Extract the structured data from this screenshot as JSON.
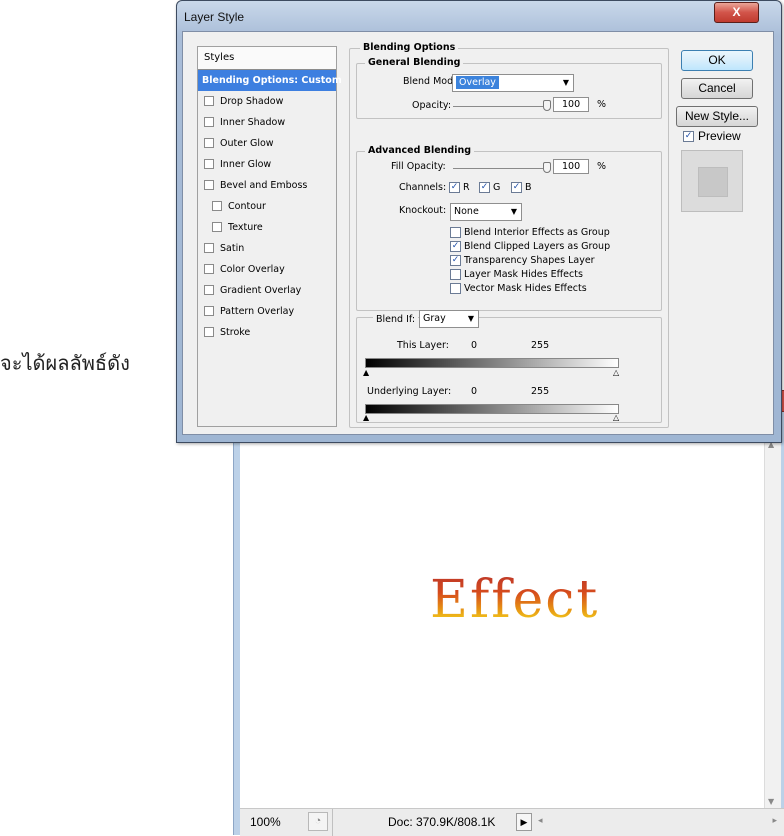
{
  "caption": "จะได้ผลลัพธ์ดัง",
  "dialog": {
    "title": "Layer Style",
    "close_label": "X"
  },
  "styles_panel": {
    "header": "Styles",
    "items": [
      {
        "label": "Blending Options: Custom",
        "checked": false,
        "active": true
      },
      {
        "label": "Drop Shadow",
        "checked": false
      },
      {
        "label": "Inner Shadow",
        "checked": false
      },
      {
        "label": "Outer Glow",
        "checked": false
      },
      {
        "label": "Inner Glow",
        "checked": false
      },
      {
        "label": "Bevel and Emboss",
        "checked": false
      },
      {
        "label": "Contour",
        "checked": false,
        "sub": true
      },
      {
        "label": "Texture",
        "checked": false,
        "sub": true
      },
      {
        "label": "Satin",
        "checked": false
      },
      {
        "label": "Color Overlay",
        "checked": false
      },
      {
        "label": "Gradient Overlay",
        "checked": false
      },
      {
        "label": "Pattern Overlay",
        "checked": false
      },
      {
        "label": "Stroke",
        "checked": false
      }
    ]
  },
  "blending": {
    "section_title": "Blending Options",
    "general": {
      "title": "General Blending",
      "blend_mode_label": "Blend Mode:",
      "blend_mode_value": "Overlay",
      "opacity_label": "Opacity:",
      "opacity_value": "100",
      "percent": "%"
    },
    "advanced": {
      "title": "Advanced Blending",
      "fill_opacity_label": "Fill Opacity:",
      "fill_opacity_value": "100",
      "percent": "%",
      "channels_label": "Channels:",
      "channel_r": "R",
      "channel_g": "G",
      "channel_b": "B",
      "knockout_label": "Knockout:",
      "knockout_value": "None",
      "options": [
        {
          "label": "Blend Interior Effects as Group",
          "checked": false
        },
        {
          "label": "Blend Clipped Layers as Group",
          "checked": true
        },
        {
          "label": "Transparency Shapes Layer",
          "checked": true
        },
        {
          "label": "Layer Mask Hides Effects",
          "checked": false
        },
        {
          "label": "Vector Mask Hides Effects",
          "checked": false
        }
      ]
    },
    "blend_if": {
      "label": "Blend If:",
      "value": "Gray",
      "this_layer_label": "This Layer:",
      "this_layer_min": "0",
      "this_layer_max": "255",
      "underlying_label": "Underlying Layer:",
      "underlying_min": "0",
      "underlying_max": "255"
    }
  },
  "buttons": {
    "ok": "OK",
    "cancel": "Cancel",
    "new_style": "New Style...",
    "preview_label": "Preview",
    "preview_checked": true
  },
  "document": {
    "effect_text": "Effect",
    "zoom": "100%",
    "doc_size": "Doc: 370.9K/808.1K"
  },
  "colors": {
    "selection_blue": "#3d7fe0",
    "dialog_frame": "#a9bdd8",
    "close_red": "#c03b2f"
  }
}
